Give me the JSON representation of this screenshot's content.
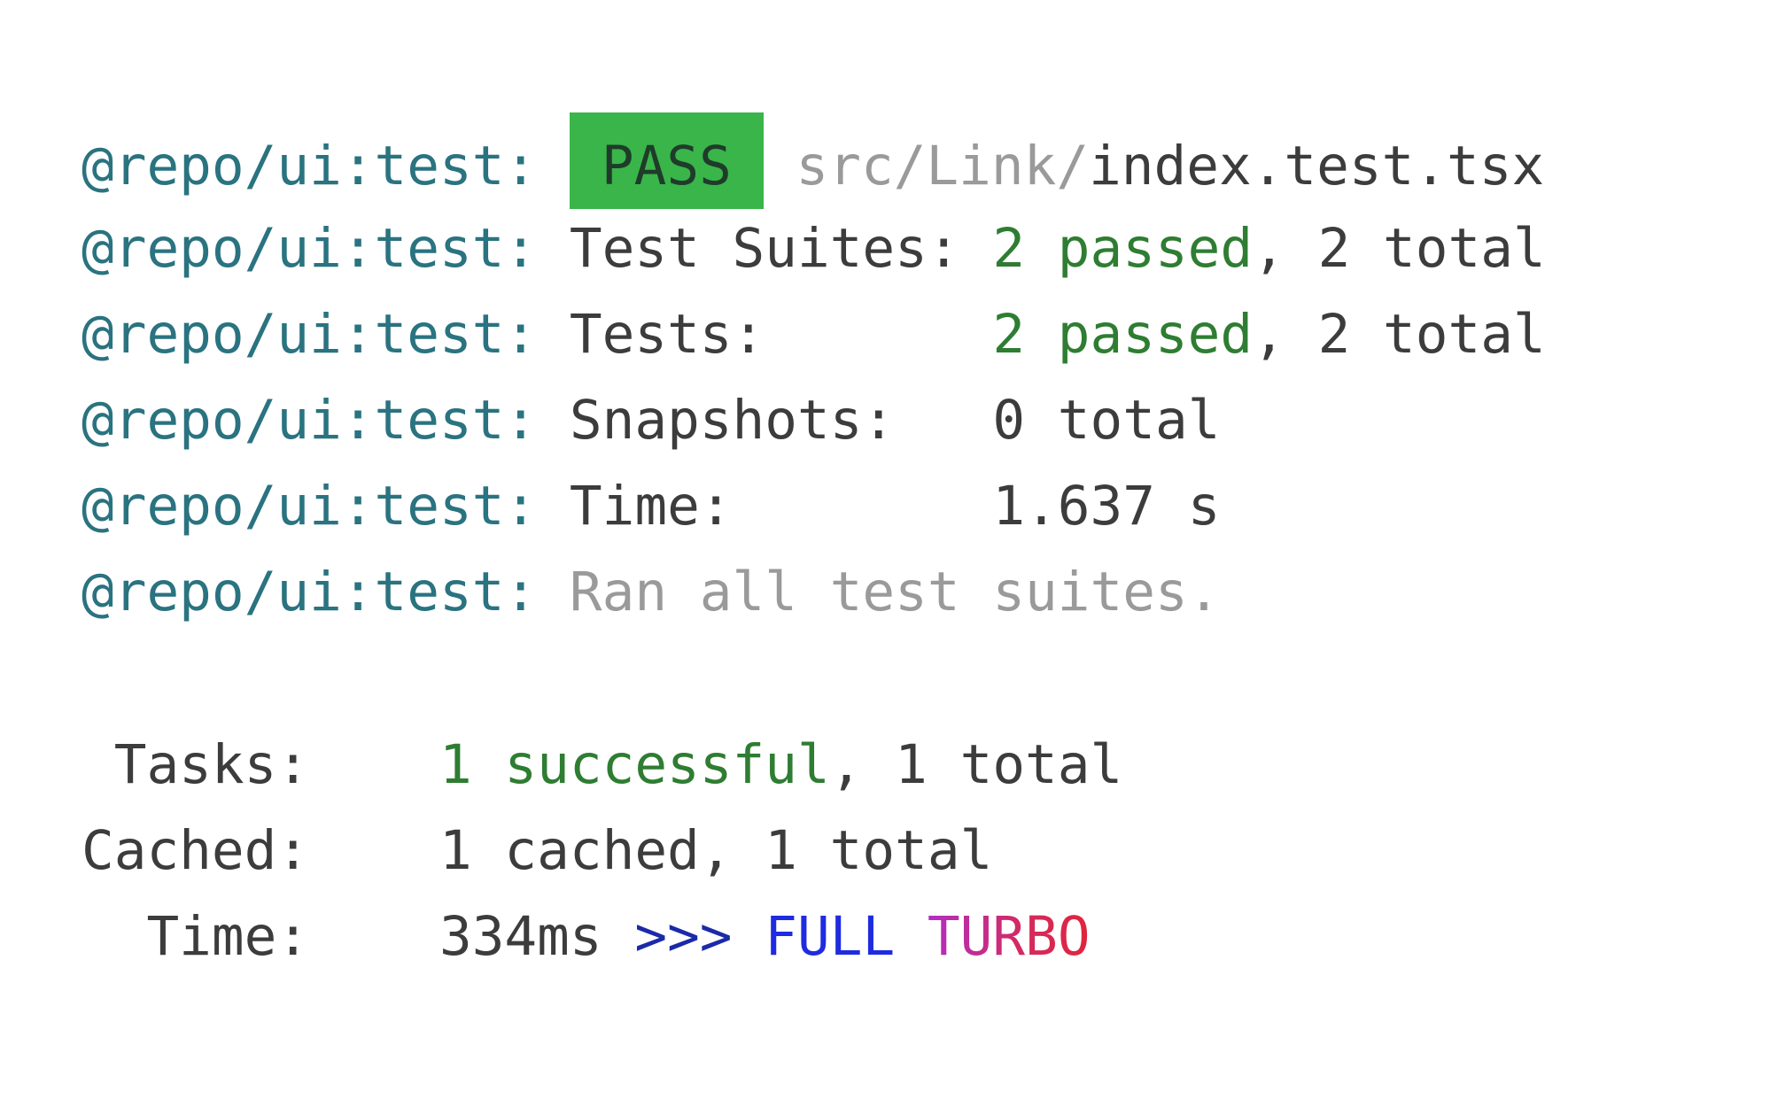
{
  "jest_output": {
    "prefix": "@repo/ui:test:",
    "pass_label": "PASS",
    "file_dir": "src/Link/",
    "file_name": "index.test.tsx",
    "rows": [
      {
        "label": "Test Suites:",
        "pad": " ",
        "passed": "2 passed",
        "sep": ",",
        "total": " 2 total"
      },
      {
        "label": "Tests:",
        "pad": "       ",
        "passed": "2 passed",
        "sep": ",",
        "total": " 2 total"
      },
      {
        "label": "Snapshots:",
        "pad": "   ",
        "value": "0 total"
      },
      {
        "label": "Time:",
        "pad": "        ",
        "value": "1.637 s"
      }
    ],
    "ran_all": "Ran all test suites."
  },
  "turbo_summary": {
    "tasks_label": " Tasks:",
    "tasks_successful": "1 successful",
    "tasks_rest": ", 1 total",
    "cached_label": "Cached:",
    "cached_value": "1 cached, 1 total",
    "time_label": "  Time:",
    "time_value": "334ms",
    "arrows": ">>>",
    "full": "FULL",
    "turbo": "TURBO"
  },
  "colors": {
    "prefix": "#2a7380",
    "passed_green": "#2e7d32",
    "badge_bg": "#39b54a",
    "full_blue": "#1e2be0",
    "turbo_gradient": [
      "#b22ec4",
      "#e0243c"
    ]
  }
}
